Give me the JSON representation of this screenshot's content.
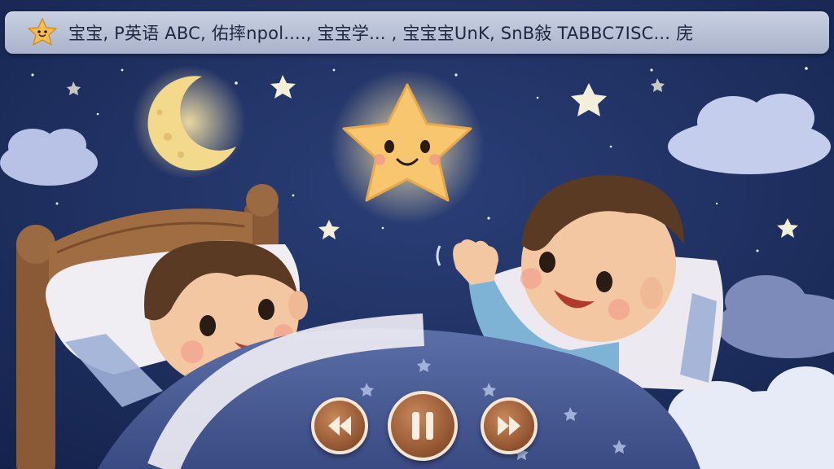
{
  "player": {
    "title": "宝宝, P英语 ABC, 佑摔npol...., 宝宝学... , 宝宝宝UnK, SnB敍 TABBC7ISC... 庑"
  },
  "controls": {
    "rewind_icon": "rewind-icon",
    "pause_icon": "pause-icon",
    "forward_icon": "fast-forward-icon"
  },
  "colors": {
    "sky": "#1d2d5c",
    "title_bar": "#b9c1d8",
    "button": "#9a5c35",
    "button_ring": "#f4e6d4"
  }
}
